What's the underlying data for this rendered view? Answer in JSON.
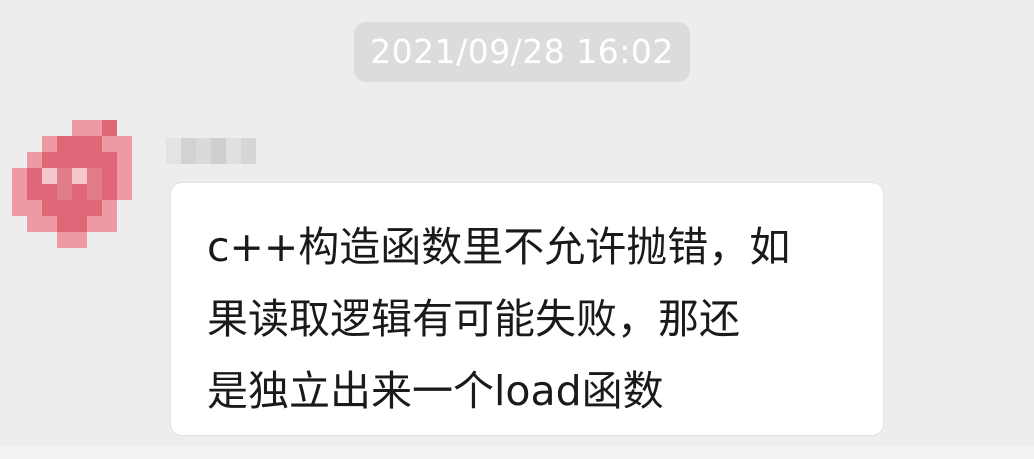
{
  "chat": {
    "timestamp": "2021/09/28 16:02",
    "message": {
      "lines": [
        "c++构造函数里不允许抛错，如",
        "果读取逻辑有可能失败，那还",
        "是独立出来一个load函数"
      ]
    }
  },
  "colors": {
    "background": "#ededed",
    "timestamp_bg": "#dcdcdc",
    "bubble_bg": "#ffffff",
    "avatar_tint": "#e06777"
  },
  "icons": {
    "avatar": "blurred-avatar",
    "sender_name": "blurred-sender-name"
  }
}
